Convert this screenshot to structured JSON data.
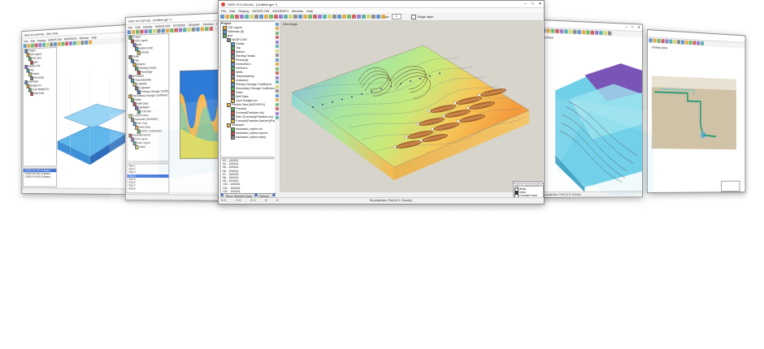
{
  "main": {
    "title": "GMS 10.5 (64-bit) - [Untitled.gpr *]",
    "menu": [
      "File",
      "Edit",
      "Display",
      "MODFLOW",
      "MODPATH",
      "Window",
      "Help"
    ],
    "project_label": "Project",
    "tree": [
      {
        "label": "GIS Layers",
        "depth": 0
      },
      {
        "label": "Materials (8)",
        "depth": 0
      },
      {
        "label": "grid",
        "depth": 0
      },
      {
        "label": "MODFLOW",
        "depth": 1
      },
      {
        "label": "Global",
        "depth": 2
      },
      {
        "label": "Top",
        "depth": 2
      },
      {
        "label": "Bottom",
        "depth": 2
      },
      {
        "label": "Starting Heads",
        "depth": 2
      },
      {
        "label": "Recharge",
        "depth": 2
      },
      {
        "label": "Horizontal k",
        "depth": 2
      },
      {
        "label": "Vertical k",
        "depth": 2
      },
      {
        "label": "Wells",
        "depth": 2
      },
      {
        "label": "Transmissivity",
        "depth": 2
      },
      {
        "label": "Leakance",
        "depth": 2
      },
      {
        "label": "Primary Storage Coefficient",
        "depth": 2
      },
      {
        "label": "Secondary Storage Coefficient",
        "depth": 2
      },
      {
        "label": "Drain",
        "depth": 2
      },
      {
        "label": "Well Data",
        "depth": 2
      },
      {
        "label": "Zone Budget.ccc",
        "depth": 2
      },
      {
        "label": "Particle Sets (MODPATH)",
        "depth": 1
      },
      {
        "label": "Forward",
        "depth": 2
      },
      {
        "label": "Forward(Particles.vtx)",
        "depth": 2
      },
      {
        "label": "Start (Forward)(Particles.vtx)",
        "depth": 2
      },
      {
        "label": "Forward(Particles (before)(Particles.vtx)",
        "depth": 2
      },
      {
        "label": "backward",
        "depth": 1
      },
      {
        "label": "backward_mpths.vtx",
        "depth": 2
      },
      {
        "label": "backward_mpths.mpend",
        "depth": 2
      },
      {
        "label": "backward_mpths.mptrp",
        "depth": 2
      }
    ],
    "timesteps": [
      "93... 10000/1",
      "94... 10000/1",
      "95... 10000/1",
      "96... 10000/1",
      "97... 10000/1",
      "98... 10000/1",
      "99... 10000/1",
      "100... 10000/1",
      "101... 10000/1",
      "102... 10000/1",
      "103... 10000/1",
      "104... 10000/1"
    ],
    "selected_timestep": 11,
    "show_label": "Show Selected Data",
    "options_label": "Options...",
    "viewport_label": "View Angle",
    "layer_label": "Layer:",
    "layer_value": "1",
    "single_layer_label": "Single layer",
    "statusbar": "No projection, Feet (U.S. Survey)",
    "coords": [
      "X: 0",
      "Y: 0",
      "Z: 0",
      "0",
      "0"
    ],
    "legend_title": "MODFLOW/MODPATH Symbols",
    "legend_items": [
      "Wells",
      "Drain",
      "Constant Head"
    ]
  },
  "left_window": {
    "title": "GMS 10.5 (64-bit) - [Sim Gws]",
    "menu": [
      "File",
      "Edit",
      "Display",
      "MODFLOW",
      "MODPATH",
      "Window",
      "Help"
    ],
    "tree": [
      "Project",
      "GIS Layers",
      "Sim Gws",
      "grid",
      "MODFLOW",
      "Top",
      "Bottom",
      "Recharge",
      "Well Data",
      "Budget.ccc",
      "Zone Budget.ccc",
      "Map Data"
    ],
    "list": [
      "4.000E+00 5.0E-04 Beams",
      "4.000E+00 5.0E-04 Beams",
      "1.500E+01 5.0E-04 Beams"
    ],
    "options_label": "Options...",
    "show_label": "Show Selected Data"
  },
  "second_window": {
    "title": "GMS 10.5 (64-bit) - [Untitled.gpr *]",
    "menu": [
      "File",
      "Edit",
      "Display",
      "MODFLOW",
      "MT3DMS",
      "SEAWAT",
      "Window",
      "Help"
    ],
    "tree": [
      "Project",
      "GIS Layers",
      "grid",
      "MODFLOW",
      "Global",
      "Drain",
      "Top",
      "Bottom",
      "Starting Heads",
      "Recharge",
      "MT3DMS",
      "Transmissivity",
      "ICBUND",
      "Leakance",
      "Primary Storage Coefficient",
      "Secondary Storage Coefficient",
      "Wells",
      "Well Data",
      "SEAWAT",
      "ICBUND",
      "Concentration",
      "Materials (SEAWAT)",
      "Sim Gws",
      "Well Data",
      "GMS_Parameters",
      "Subwatersheds",
      "Soil Layers",
      "Well Layers",
      "Head"
    ],
    "list": [
      "Step 1",
      "Step 2",
      "Step 3",
      "Step 4",
      "Step 5",
      "Step 6",
      "Step 7",
      "Step 8"
    ],
    "selected": 3,
    "options_label": "Options...",
    "show_label": "Show Selected Data"
  },
  "fourth_window": {
    "side_label": "Surface",
    "statusbar": "No projection, Feet (U.S. Survey)"
  },
  "fifth_window": {
    "side_label": "Surface plots"
  },
  "colors": {
    "contour_low": "#f7c85a",
    "contour_mid": "#a6e6a0",
    "contour_high": "#7fb5f0",
    "selection": "#3a6fd8"
  }
}
